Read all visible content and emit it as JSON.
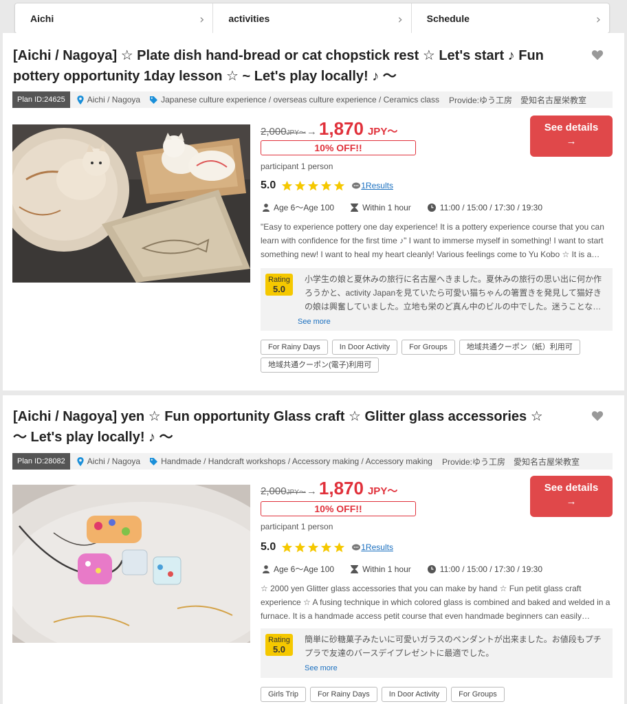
{
  "selectors": [
    {
      "label": "Aichi"
    },
    {
      "label": "activities"
    },
    {
      "label": "Schedule"
    }
  ],
  "chevron_glyph": "›",
  "cards": [
    {
      "title_line1": "[Aichi / Nagoya] ☆ Plate dish hand-bread or cat chopstick rest ☆ Let's start ♪ Fun",
      "title_line2": "pottery opportunity 1day lesson ☆ ~ Let's play locally! ♪ 〜",
      "plan_id": "Plan ID:24625",
      "location": "Aichi / Nagoya",
      "category": "Japanese culture experience / overseas culture experience / Ceramics class",
      "provider": "Provide:ゆう工房　愛知名古屋栄教室",
      "old_price": "2,000",
      "old_currency": "JPY〜",
      "arrow": "→",
      "new_price": "1,870",
      "new_currency": "JPY〜",
      "discount": "10% OFF!!",
      "participant": "participant 1 person",
      "score": "5.0",
      "results": "1Results",
      "age": "Age 6〜Age 100",
      "duration": "Within 1 hour",
      "times": "11:00 / 15:00 / 17:30 / 19:30",
      "description": "\"Easy to experience pottery one day experience! It is a pottery experience course that you can learn with confidence for the first time ♪\" I want to immerse myself in something! I want to start something new! I want to heal my heart cleanly! Various feelings come to Yu Kobo ☆ It is a…",
      "rating_label": "Rating",
      "rating_value": "5.0",
      "review": "小学生の娘と夏休みの旅行に名古屋へきました。夏休みの旅行の思い出に何か作ろうかと、activity Japanを見ていたら可愛い猫ちゃんの箸置きを発見して猫好きの娘は興奮していました。立地も栄のど真ん中のビルの中でした。迷うことな…",
      "see_more": "See more",
      "details_label": "See details",
      "details_arrow": "→",
      "tags": [
        "For Rainy Days",
        "In Door Activity",
        "For Groups",
        "地域共通クーポン（紙）利用可",
        "地域共通クーポン(電子)利用可"
      ]
    },
    {
      "title_line1": "[Aichi / Nagoya] yen ☆ Fun opportunity Glass craft ☆ Glitter glass accessories ☆",
      "title_line2": "〜 Let's play locally! ♪ 〜",
      "plan_id": "Plan ID:28082",
      "location": "Aichi / Nagoya",
      "category": "Handmade / Handcraft workshops / Accessory making / Accessory making",
      "provider": "Provide:ゆう工房　愛知名古屋栄教室",
      "old_price": "2,000",
      "old_currency": "JPY〜",
      "arrow": "→",
      "new_price": "1,870",
      "new_currency": "JPY〜",
      "discount": "10% OFF!!",
      "participant": "participant 1 person",
      "score": "5.0",
      "results": "1Results",
      "age": "Age 6〜Age 100",
      "duration": "Within 1 hour",
      "times": "11:00 / 15:00 / 17:30 / 19:30",
      "description": "☆ 2000 yen Glitter glass accessories that you can make by hand ☆ Fun petit glass craft experience ☆ A fusing technique in which colored glass is combined and baked and welded in a furnace. It is a handmade access petit course that even handmade beginners can easily…",
      "rating_label": "Rating",
      "rating_value": "5.0",
      "review": "簡単に砂糖菓子みたいに可愛いガラスのペンダントが出来ました。お値段もプチプラで友達のバースデイプレゼントに最適でした。",
      "see_more": "See more",
      "details_label": "See details",
      "details_arrow": "→",
      "tags": [
        "Girls Trip",
        "For Rainy Days",
        "In Door Activity",
        "For Groups"
      ]
    }
  ],
  "colors": {
    "accent_red": "#e0303a",
    "button_red": "#e0484a",
    "star_yellow": "#f5c800",
    "link_blue": "#1a6fbf"
  }
}
